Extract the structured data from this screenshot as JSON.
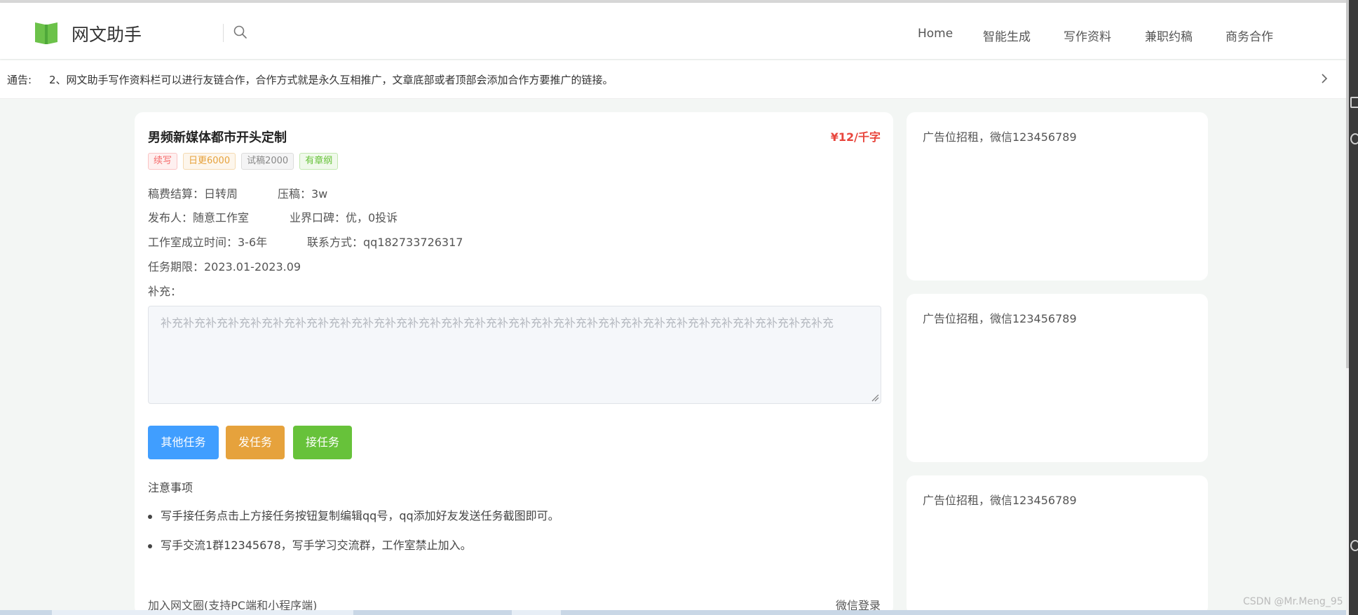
{
  "header": {
    "logo_text": "网文助手",
    "nav": [
      "Home",
      "智能生成",
      "写作资料",
      "兼职约稿",
      "商务合作"
    ]
  },
  "notice": {
    "label": "通告:",
    "text": "2、网文助手写作资料栏可以进行友链合作，合作方式就是永久互相推广，文章底部或者顶部会添加合作方要推广的链接。"
  },
  "job": {
    "title": "男频新媒体都市开头定制",
    "price": "¥12/千字",
    "tags": [
      "续写",
      "日更6000",
      "试稿2000",
      "有章纲"
    ],
    "info": {
      "settlement": "稿费结算：日转周",
      "deposit": "压稿：3w",
      "publisher": "发布人：随意工作室",
      "reputation": "业界口碑：优，0投诉",
      "founded": "工作室成立时间：3-6年",
      "contact": "联系方式：qq182733726317",
      "period": "任务期限：2023.01-2023.09",
      "supplement_label": "补充："
    },
    "supplement_placeholder": "补充补充补充补充补充补充补充补充补充补充补充补充补充补充补充补充补充补充补充补充补充补充补充补充补充补充补充补充补充补充",
    "buttons": {
      "other": "其他任务",
      "post": "发任务",
      "accept": "接任务"
    },
    "notes_title": "注意事项",
    "notes": [
      "写手接任务点击上方接任务按钮复制编辑qq号，qq添加好友发送任务截图即可。",
      "写手交流1群12345678，写手学习交流群，工作室禁止加入。"
    ],
    "footer_left": "加入网文圈(支持PC端和小程序端)",
    "footer_right": "微信登录"
  },
  "ads": [
    "广告位招租，微信123456789",
    "广告位招租，微信123456789",
    "广告位招租，微信123456789"
  ],
  "watermark": "CSDN @Mr.Meng_95",
  "colors": {
    "primary_blue": "#409eff",
    "orange": "#e6a23c",
    "green": "#67c23a",
    "price_red": "#e8453c",
    "logo_green": "#6cc24a"
  }
}
